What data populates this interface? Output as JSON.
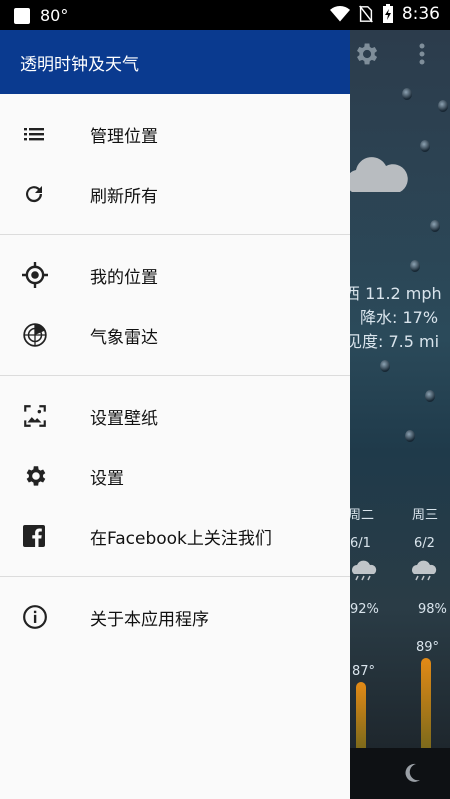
{
  "status_bar": {
    "temperature": "80°",
    "time": "8:36"
  },
  "drawer": {
    "title": "透明时钟及天气",
    "groups": [
      [
        {
          "label": "管理位置",
          "icon": "list-icon"
        },
        {
          "label": "刷新所有",
          "icon": "refresh-icon"
        }
      ],
      [
        {
          "label": "我的位置",
          "icon": "my-location-icon"
        },
        {
          "label": "气象雷达",
          "icon": "radar-icon"
        }
      ],
      [
        {
          "label": "设置壁纸",
          "icon": "wallpaper-icon"
        },
        {
          "label": "设置",
          "icon": "gear-icon"
        },
        {
          "label": "在Facebook上关注我们",
          "icon": "facebook-icon"
        }
      ],
      [
        {
          "label": "关于本应用程序",
          "icon": "info-icon"
        }
      ]
    ]
  },
  "background": {
    "wind": "西 11.2 mph",
    "precipitation": "降水: 17%",
    "visibility": "见度: 7.5 mi",
    "days": [
      {
        "name": "周二",
        "date": "6/1",
        "humidity": "92%",
        "high": "87°"
      },
      {
        "name": "周三",
        "date": "6/2",
        "humidity": "98%",
        "high": "89°"
      }
    ]
  },
  "colors": {
    "header": "#0a3a8f",
    "status_bar": "#000000",
    "drawer_bg": "#fafafa",
    "bar": "#e38a16"
  }
}
